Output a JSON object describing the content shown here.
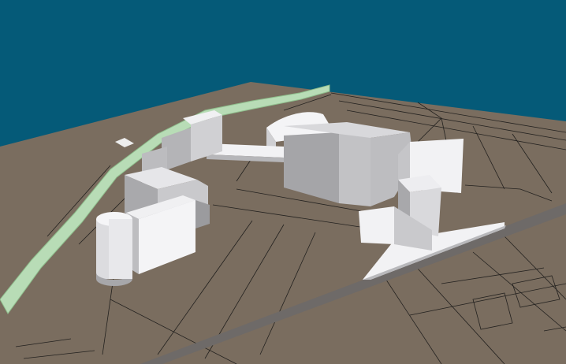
{
  "scene": {
    "colors": {
      "sky": "#055a78",
      "ground": "#7a6d5f",
      "green_strip": "#b8dcb6",
      "road": "#6e6a68",
      "building_light": "#f2f2f4",
      "building_mid": "#cfcfd2",
      "building_shadow": "#9b9b9e",
      "plan_lines": "#141414"
    },
    "objects": [
      "ground-plane",
      "green-strip",
      "road-band",
      "cylinder-tower",
      "slab-building-west",
      "zigzag-wing",
      "bridge-corridor",
      "main-block",
      "tower-east",
      "curved-roof-hall",
      "wedge-building"
    ]
  }
}
